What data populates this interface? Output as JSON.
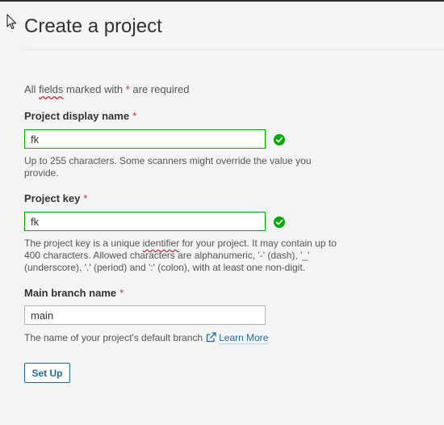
{
  "page": {
    "title": "Create a project"
  },
  "required_note": {
    "prefix": "All ",
    "squiggle_word": "fields",
    "middle": " marked with ",
    "asterisk": "*",
    "suffix": " are required"
  },
  "fields": {
    "display_name": {
      "label": "Project display name",
      "asterisk": "*",
      "value": "fk",
      "help": "Up to 255 characters. Some scanners might override the value you provide."
    },
    "project_key": {
      "label": "Project key",
      "asterisk": "*",
      "value": "fk",
      "help_prefix": "The project key is a unique ",
      "help_squiggle": "identifier",
      "help_suffix": " for your project. It may contain up to 400 characters. Allowed characters are alphanumeric, '-' (dash), '_' (underscore), '.' (period) and ':' (colon), with at least one non-digit."
    },
    "main_branch": {
      "label": "Main branch name",
      "asterisk": "*",
      "value": "main",
      "help": "The name of your project's default branch",
      "learn_more": "Learn More"
    }
  },
  "actions": {
    "setup_label": "Set Up"
  },
  "colors": {
    "valid_green": "#00aa00",
    "required_red": "#d02f3a",
    "link_blue": "#236a97"
  },
  "icons": {
    "valid": "check-circle-icon",
    "external": "external-link-icon",
    "cursor": "mouse-pointer-icon"
  }
}
